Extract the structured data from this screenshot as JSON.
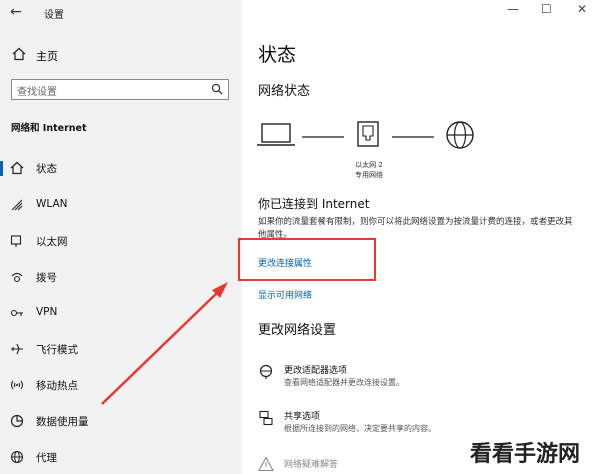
{
  "window": {
    "title": "设置",
    "minimize": "—",
    "maximize": "☐",
    "close": "✕"
  },
  "sidebar": {
    "home_label": "主页",
    "search_placeholder": "查找设置",
    "section_title": "网络和 Internet",
    "items": [
      {
        "label": "状态",
        "icon": "home-house-icon",
        "active": true
      },
      {
        "label": "WLAN",
        "icon": "wifi-icon"
      },
      {
        "label": "以太网",
        "icon": "ethernet-icon"
      },
      {
        "label": "拨号",
        "icon": "dialup-icon"
      },
      {
        "label": "VPN",
        "icon": "vpn-icon"
      },
      {
        "label": "飞行模式",
        "icon": "airplane-icon"
      },
      {
        "label": "移动热点",
        "icon": "hotspot-icon"
      },
      {
        "label": "数据使用量",
        "icon": "data-usage-icon"
      },
      {
        "label": "代理",
        "icon": "globe-icon"
      }
    ]
  },
  "main": {
    "page_title": "状态",
    "network_status_title": "网络状态",
    "adapter_label_line1": "以太网 2",
    "adapter_label_line2": "专用网络",
    "connected_title": "你已连接到 Internet",
    "connected_desc": "如果你的流量套餐有限制，则你可以将此网络设置为按流量计费的连接，或者更改其他属性。",
    "change_props_link": "更改连接属性",
    "show_networks_link": "显示可用网络",
    "change_settings_title": "更改网络设置",
    "options": [
      {
        "title": "更改适配器选项",
        "desc": "查看网络适配器并更改连接设置。"
      },
      {
        "title": "共享选项",
        "desc": "根据所连接到的网络，决定要共享的内容。"
      },
      {
        "title": "网络疑难解答",
        "desc": ""
      }
    ]
  },
  "watermark": "看看手游网",
  "colors": {
    "accent": "#0067c0",
    "link": "#0063b1",
    "highlight": "#e53935"
  }
}
